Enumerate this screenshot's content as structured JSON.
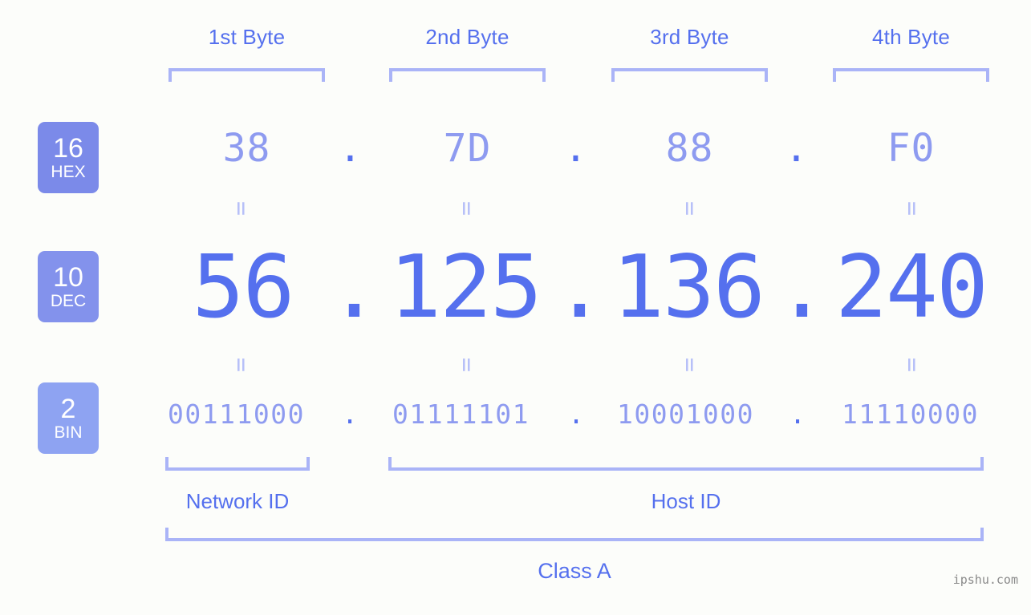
{
  "background_color": "#fcfdfa",
  "accent_strong": "#5570ee",
  "accent_light": "#8e9bf0",
  "bracket_color": "#aab4f7",
  "watermark": "ipshu.com",
  "byte_headers": [
    {
      "label": "1st Byte"
    },
    {
      "label": "2nd Byte"
    },
    {
      "label": "3rd Byte"
    },
    {
      "label": "4th Byte"
    }
  ],
  "rows": [
    {
      "base_number": "16",
      "base_name": "HEX",
      "badge_color": "#7b8ae9",
      "values": [
        "38",
        "7D",
        "88",
        "F0"
      ],
      "separator": "."
    },
    {
      "base_number": "10",
      "base_name": "DEC",
      "badge_color": "#8392ec",
      "values": [
        "56",
        "125",
        "136",
        "240"
      ],
      "separator": "."
    },
    {
      "base_number": "2",
      "base_name": "BIN",
      "badge_color": "#8ea3f2",
      "values": [
        "00111000",
        "01111101",
        "10001000",
        "11110000"
      ],
      "separator": "."
    }
  ],
  "equals_symbol": "=",
  "segments": {
    "network_id": "Network ID",
    "host_id": "Host ID",
    "class": "Class A"
  },
  "ip_address": {
    "hex": "38.7D.88.F0",
    "decimal": "56.125.136.240",
    "binary": "00111000.01111101.10001000.11110000"
  }
}
